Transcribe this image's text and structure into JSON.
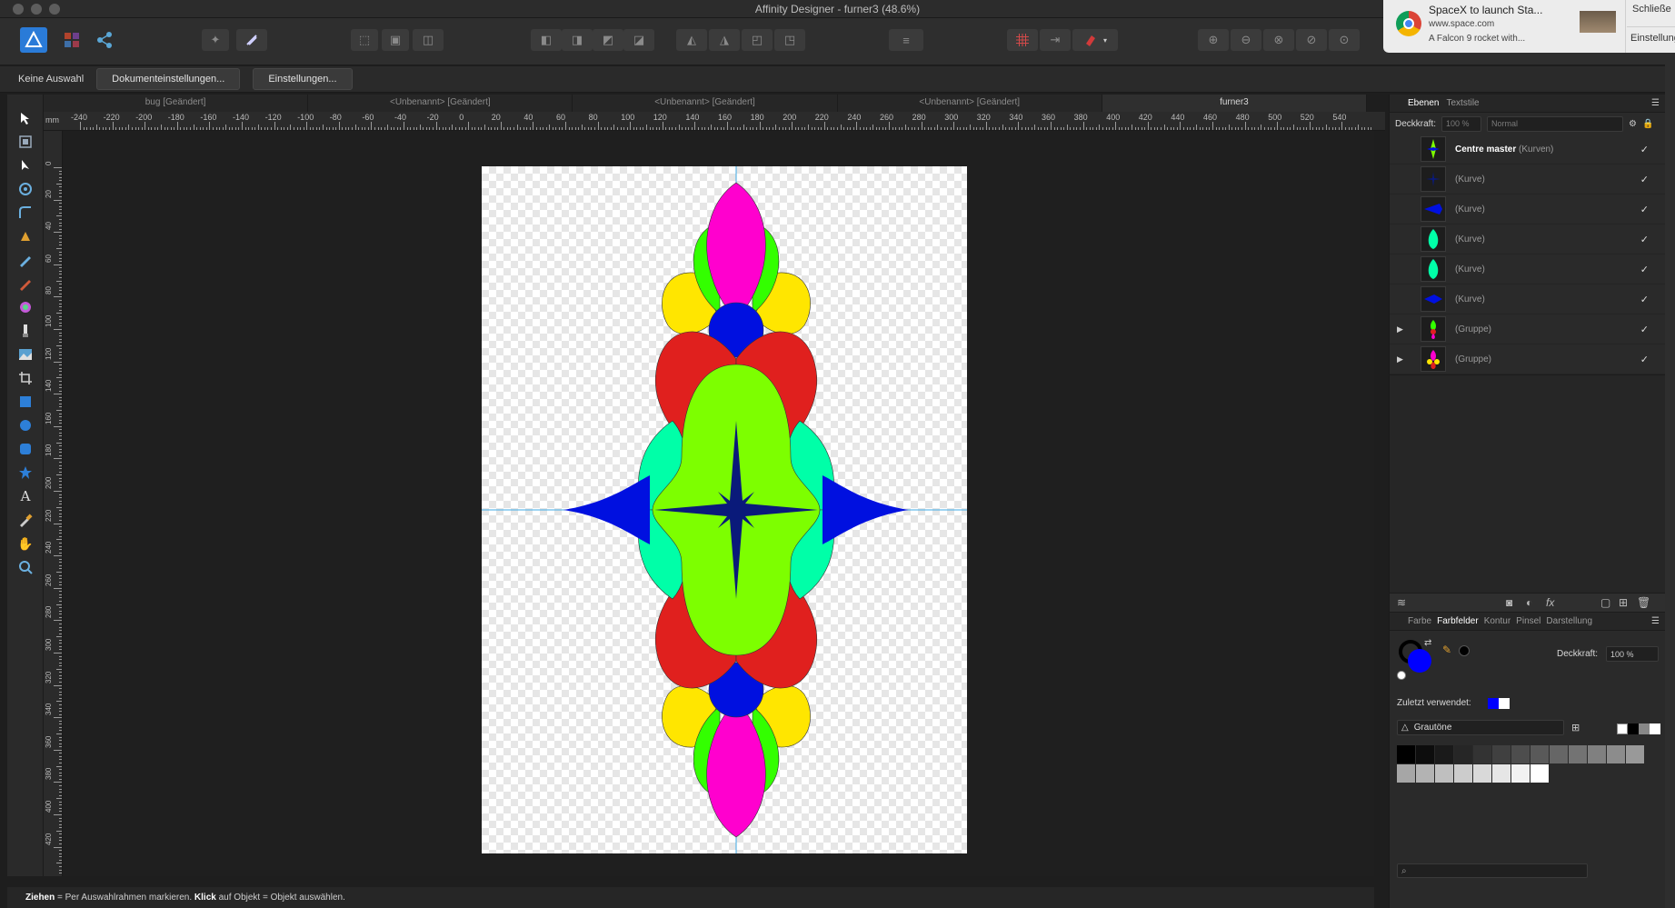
{
  "window": {
    "title": "Affinity Designer - furner3 (48.6%)"
  },
  "notification": {
    "title": "SpaceX to launch Sta...",
    "url": "www.space.com",
    "body": "A Falcon 9 rocket with...",
    "close_label": "Schließe",
    "settings_label": "Einstellung"
  },
  "context_toolbar": {
    "selection_label": "Keine Auswahl",
    "doc_settings_button": "Dokumenteinstellungen...",
    "settings_button": "Einstellungen..."
  },
  "document_tabs": [
    {
      "label": "bug [Geändert]",
      "active": false
    },
    {
      "label": "<Unbenannt> [Geändert]",
      "active": false
    },
    {
      "label": "<Unbenannt> [Geändert]",
      "active": false
    },
    {
      "label": "<Unbenannt> [Geändert]",
      "active": false
    },
    {
      "label": "furner3",
      "active": true
    }
  ],
  "rulers": {
    "unit": "mm",
    "top_ticks": [
      "-240",
      "-220",
      "-200",
      "-180",
      "-160",
      "-140",
      "-120",
      "-100",
      "-80",
      "-60",
      "-40",
      "-20",
      "0",
      "20",
      "40",
      "60",
      "80",
      "100",
      "120",
      "140",
      "160",
      "180",
      "200",
      "220",
      "240",
      "260",
      "280",
      "300",
      "320",
      "340",
      "360",
      "380",
      "400",
      "420",
      "440",
      "460",
      "480",
      "500",
      "520",
      "540"
    ],
    "left_ticks": [
      "0",
      "20",
      "40",
      "60",
      "80",
      "100",
      "120",
      "140",
      "160",
      "180",
      "200",
      "220",
      "240",
      "260",
      "280",
      "300",
      "320",
      "340",
      "360",
      "380",
      "400",
      "420"
    ]
  },
  "status_bar": {
    "action1": "Ziehen",
    "text1": " = Per Auswahlrahmen markieren. ",
    "action2": "Klick",
    "text2": " auf Objekt = Objekt auswählen."
  },
  "layers_panel": {
    "tabs": [
      "Ebenen",
      "Textstile"
    ],
    "opacity_label": "Deckkraft:",
    "opacity_value": "100 %",
    "blend_mode": "Normal",
    "layers": [
      {
        "name": "Centre master",
        "kind": "(Kurven)",
        "visible": true,
        "master": true,
        "expandable": false,
        "thumb": "green-star"
      },
      {
        "name": "",
        "kind": "(Kurve)",
        "visible": true,
        "master": false,
        "expandable": false,
        "thumb": "navy-star"
      },
      {
        "name": "",
        "kind": "(Kurve)",
        "visible": true,
        "master": false,
        "expandable": false,
        "thumb": "blue-flag"
      },
      {
        "name": "",
        "kind": "(Kurve)",
        "visible": true,
        "master": false,
        "expandable": false,
        "thumb": "teal-drop"
      },
      {
        "name": "",
        "kind": "(Kurve)",
        "visible": true,
        "master": false,
        "expandable": false,
        "thumb": "teal-drop"
      },
      {
        "name": "",
        "kind": "(Kurve)",
        "visible": true,
        "master": false,
        "expandable": false,
        "thumb": "blue-point"
      },
      {
        "name": "",
        "kind": "(Gruppe)",
        "visible": true,
        "master": false,
        "expandable": true,
        "thumb": "group-a"
      },
      {
        "name": "",
        "kind": "(Gruppe)",
        "visible": true,
        "master": false,
        "expandable": true,
        "thumb": "group-b"
      }
    ]
  },
  "color_panel": {
    "tabs": [
      "Farbe",
      "Farbfelder",
      "Kontur",
      "Pinsel",
      "Darstellung"
    ],
    "active_tab": "Farbfelder",
    "opacity_label": "Deckkraft:",
    "opacity_value": "100 %",
    "recent_label": "Zuletzt verwendet:",
    "palette_name": "Grautöne",
    "fill_color": "#0000ff",
    "stroke_color": "#000000",
    "recent_colors": [
      "#0000ff",
      "#ffffff"
    ],
    "gray_swatches": [
      "#000000",
      "#0d0d0d",
      "#1a1a1a",
      "#262626",
      "#333333",
      "#404040",
      "#4d4d4d",
      "#595959",
      "#666666",
      "#737373",
      "#808080",
      "#8c8c8c",
      "#999999",
      "#a6a6a6",
      "#b3b3b3",
      "#bfbfbf",
      "#cccccc",
      "#d9d9d9",
      "#e6e6e6",
      "#f2f2f2",
      "#ffffff"
    ]
  }
}
